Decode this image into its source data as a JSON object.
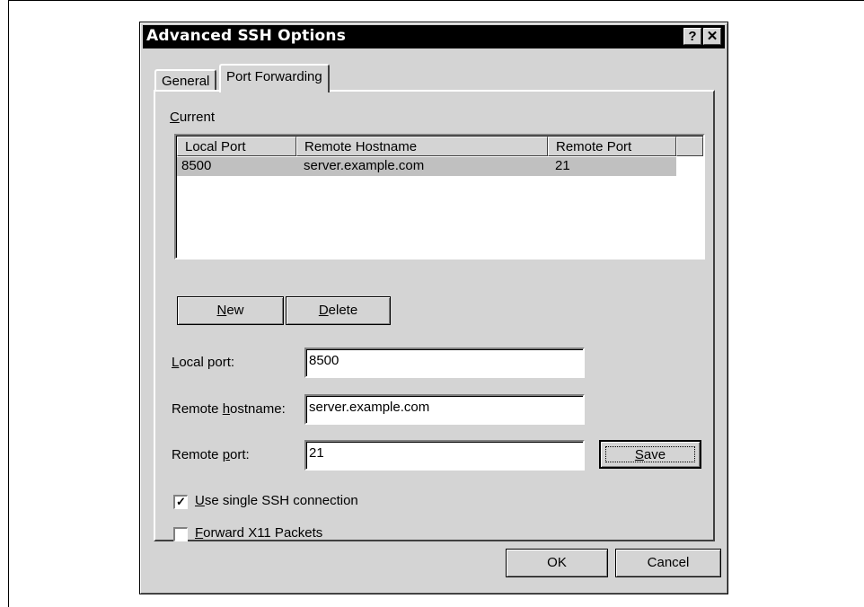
{
  "window": {
    "title": "Advanced SSH Options",
    "help_glyph": "?",
    "close_glyph": "✕"
  },
  "tabs": [
    {
      "label": "General",
      "active": false
    },
    {
      "label": "Port Forwarding",
      "active": true
    }
  ],
  "current": {
    "label_ul": "C",
    "label_rest": "urrent",
    "columns": [
      "Local Port",
      "Remote Hostname",
      "Remote Port"
    ],
    "rows": [
      {
        "local_port": "8500",
        "remote_hostname": "server.example.com",
        "remote_port": "21",
        "selected": true
      }
    ]
  },
  "buttons": {
    "new_ul": "N",
    "new_rest": "ew",
    "delete_ul": "D",
    "delete_rest": "elete",
    "save_ul": "S",
    "save_rest": "ave",
    "ok": "OK",
    "cancel": "Cancel"
  },
  "form": {
    "local_port_label_ul": "L",
    "local_port_label_rest": "ocal port:",
    "local_port_value": "8500",
    "remote_hostname_label_pre": "Remote ",
    "remote_hostname_label_ul": "h",
    "remote_hostname_label_rest": "ostname:",
    "remote_hostname_value": "server.example.com",
    "remote_port_label_pre": "Remote ",
    "remote_port_label_ul": "p",
    "remote_port_label_rest": "ort:",
    "remote_port_value": "21"
  },
  "options": {
    "single_ssh_ul": "U",
    "single_ssh_rest": "se single SSH connection",
    "single_ssh_checked": true,
    "check_glyph": "✓",
    "forward_x11_ul": "F",
    "forward_x11_rest": "orward X11 Packets",
    "forward_x11_checked": false
  }
}
